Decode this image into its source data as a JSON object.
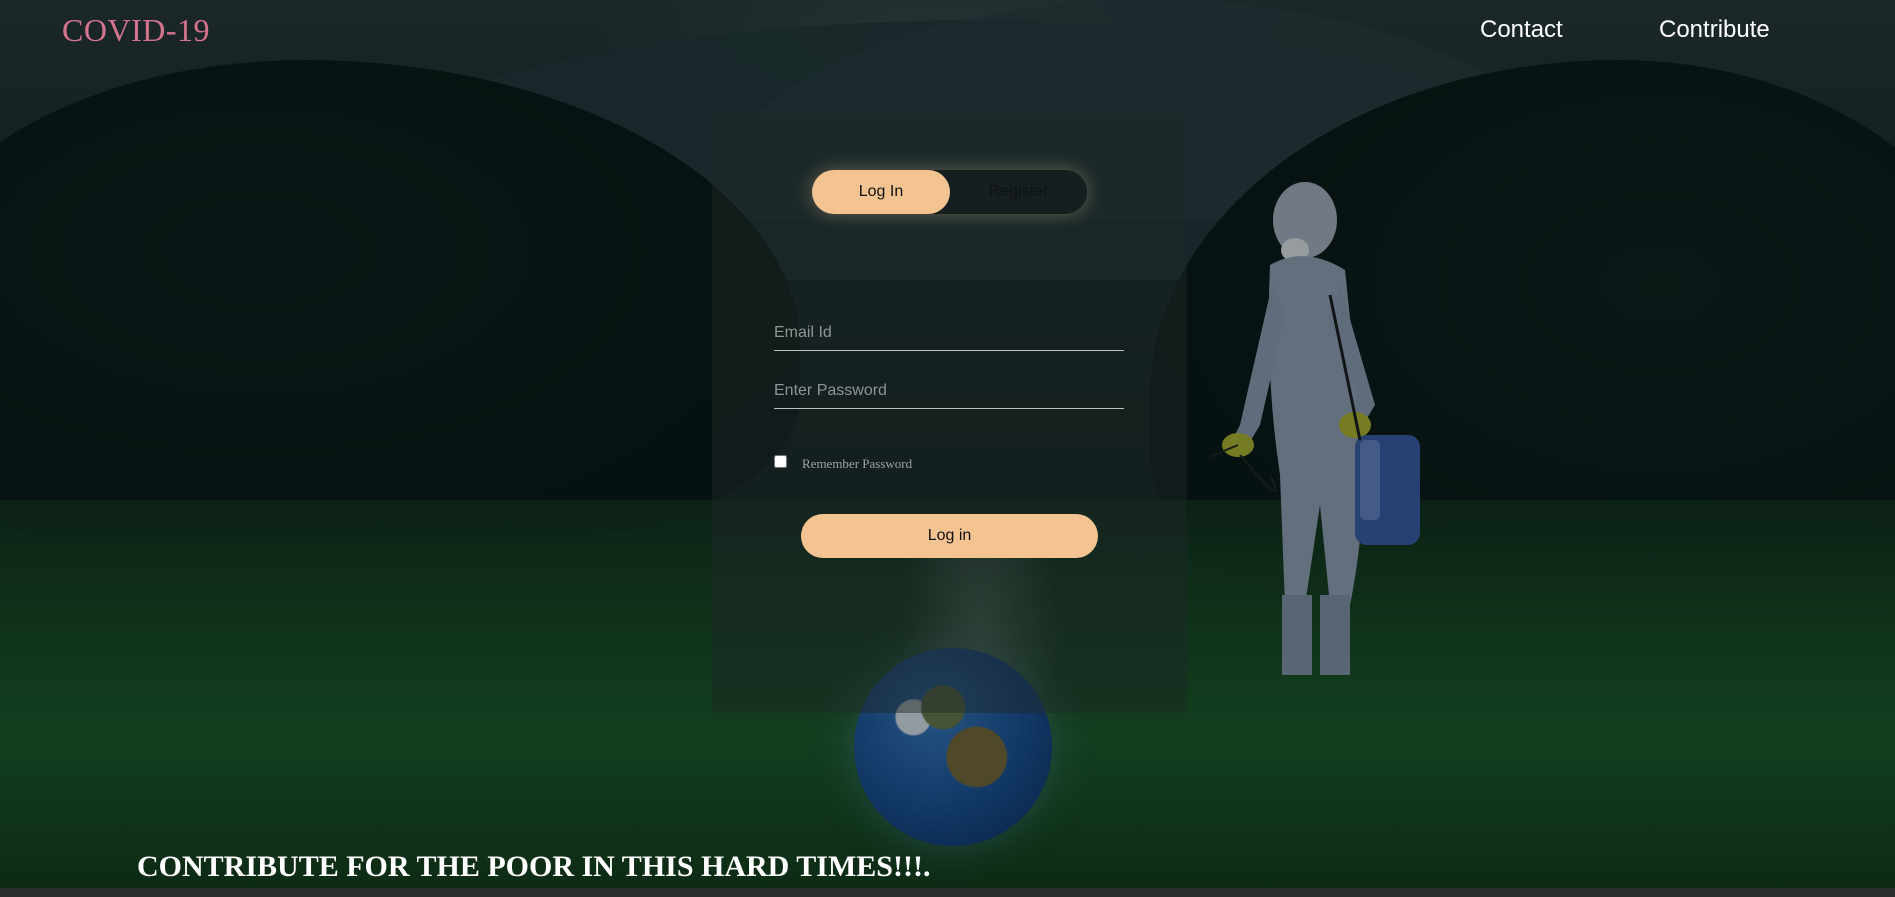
{
  "header": {
    "brand": "COVID-19",
    "nav": [
      {
        "label": "Contact"
      },
      {
        "label": "Contribute"
      }
    ]
  },
  "login_form": {
    "tabs": [
      {
        "label": "Log In",
        "active": true
      },
      {
        "label": "Register",
        "active": false
      }
    ],
    "email": {
      "value": "",
      "placeholder": "Email Id"
    },
    "password": {
      "value": "",
      "placeholder": "Enter Password"
    },
    "remember": {
      "label": "Remember Password",
      "checked": false
    },
    "submit_label": "Log in"
  },
  "footer": {
    "tagline": "CONTRIBUTE FOR THE POOR IN THIS HARD TIMES!!!."
  },
  "colors": {
    "accent": "#f3c491",
    "brand": "#d4748f",
    "text": "#ffffff"
  },
  "background": {
    "image_icon": "landscape-photo-icon"
  }
}
